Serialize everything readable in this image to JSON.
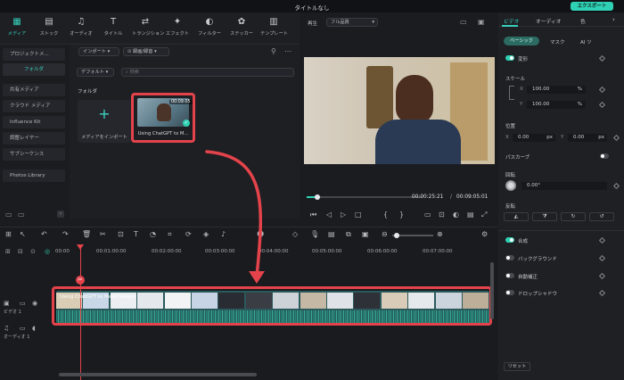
{
  "window": {
    "title": "タイトルなし",
    "export_label": "エクスポート"
  },
  "toolbar": {
    "items": [
      {
        "label": "メディア",
        "icon": "media-icon",
        "active": true
      },
      {
        "label": "ストック",
        "icon": "stock-icon"
      },
      {
        "label": "オーディオ",
        "icon": "audio-icon"
      },
      {
        "label": "タイトル",
        "icon": "title-icon"
      },
      {
        "label": "トランジション",
        "icon": "transition-icon"
      },
      {
        "label": "エフェクト",
        "icon": "effect-icon"
      },
      {
        "label": "フィルター",
        "icon": "filter-icon"
      },
      {
        "label": "ステッカー",
        "icon": "sticker-icon"
      },
      {
        "label": "テンプレート",
        "icon": "template-icon"
      }
    ]
  },
  "sidebar": {
    "items": [
      {
        "label": "プロジェクトメ...",
        "selected": false
      },
      {
        "label": "フォルダ",
        "selected": true
      },
      {
        "label": "共有メディア",
        "selected": false
      },
      {
        "label": "クラウド メディア",
        "selected": false
      },
      {
        "label": "Influence Kit",
        "selected": false
      },
      {
        "label": "調整レイヤー",
        "selected": false
      },
      {
        "label": "サブシーケンス",
        "selected": false
      },
      {
        "label": "Photos Library",
        "selected": false
      }
    ]
  },
  "media": {
    "import_label": "インポート",
    "record_label": "録画/録音",
    "default_label": "デフォルト",
    "search_placeholder": "検索",
    "folder_heading": "フォルダ",
    "import_tile_label": "メディアをインポート",
    "clip_name": "Using ChatGPT to M...",
    "clip_duration": "00:09:05"
  },
  "preview": {
    "play_label": "再生",
    "quality_label": "フル品質",
    "current_time": "00:00:25:21",
    "separator": "/",
    "total_time": "00:09:05:01"
  },
  "inspector": {
    "tabs": [
      "ビデオ",
      "オーディオ",
      "色"
    ],
    "sub_tabs": [
      "ベーシック",
      "マスク",
      "AI ツ"
    ],
    "transform_label": "変形",
    "scale_label": "スケール",
    "scale_x": "100.00",
    "scale_y": "100.00",
    "percent": "%",
    "position_label": "位置",
    "pos_x": "0.00",
    "pos_y": "0.00",
    "px": "px",
    "x_axis": "X",
    "y_axis": "Y",
    "path_curve_label": "パスカーブ",
    "rotate_label": "回転",
    "rotate_value": "0.00°",
    "flip_label": "反転",
    "composite_label": "合成",
    "background_label": "バックグラウンド",
    "auto_enhance_label": "自動補正",
    "drop_shadow_label": "ドロップシャドウ",
    "reset_label": "リセット"
  },
  "timeline": {
    "ticks": [
      "00:00",
      "00:01:00:00",
      "00:02:00:00",
      "00:03:00:00",
      "00:04:00:00",
      "00:05:00:00",
      "00:06:00:00",
      "00:07:00:00"
    ],
    "video_track_label": "ビデオ 1",
    "audio_track_label": "オーディオ 1",
    "clip_title": "Using ChatGPT to Make Videos"
  },
  "colors": {
    "accent": "#2fd0b4",
    "highlight": "#e4434b"
  }
}
